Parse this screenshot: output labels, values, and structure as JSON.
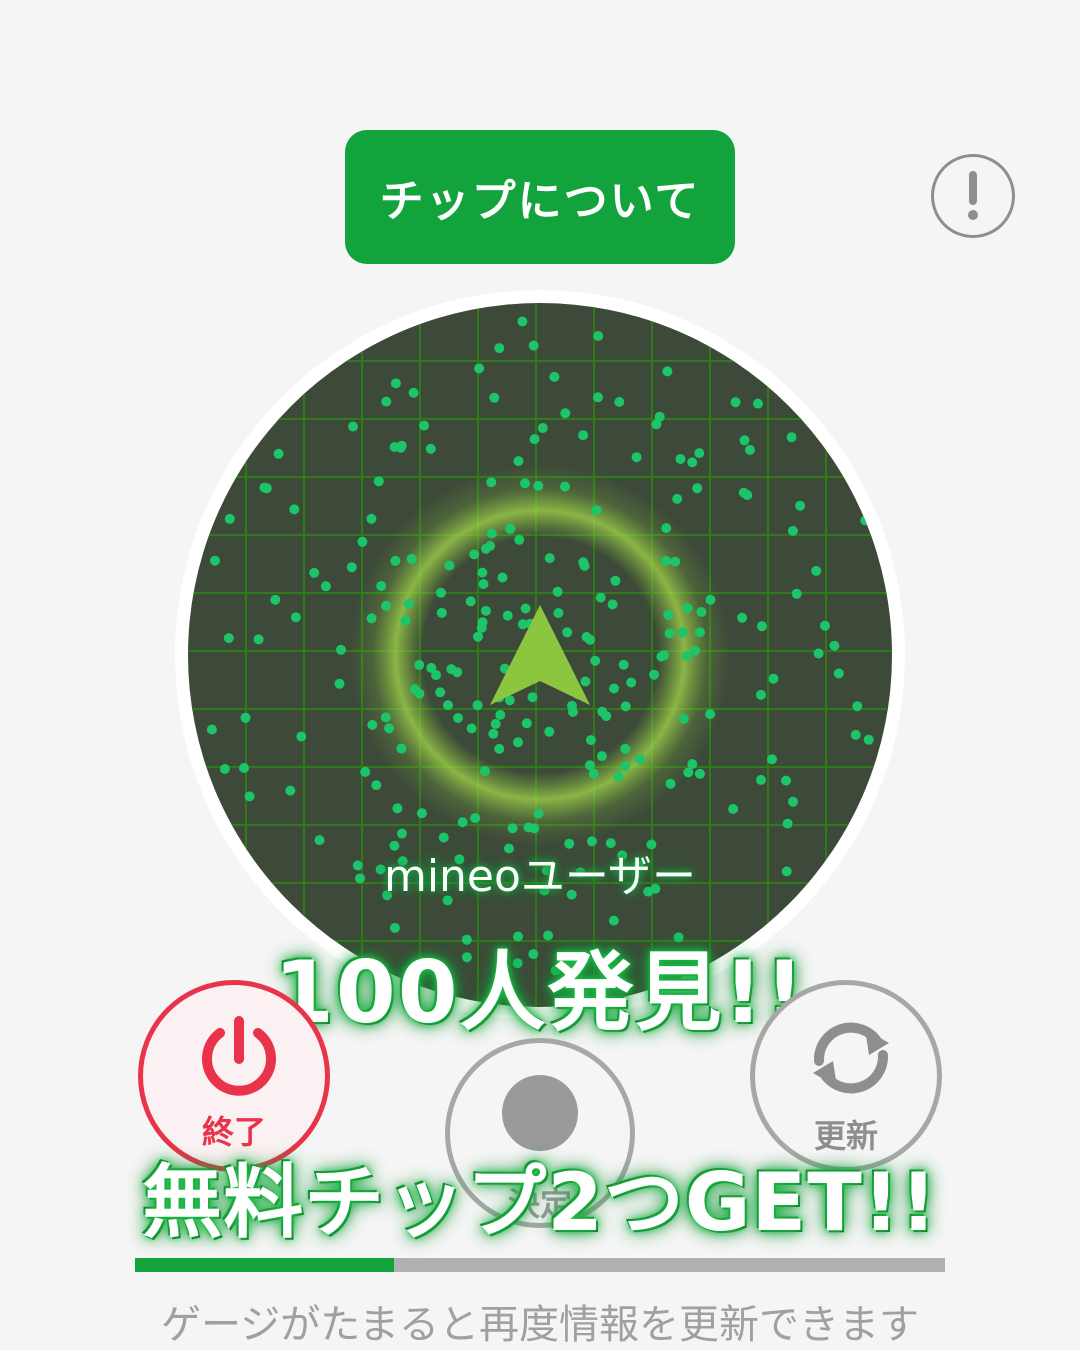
{
  "header": {
    "chip_button_label": "チップについて"
  },
  "info_icon": "exclamation-icon",
  "radar": {
    "background_color": "#3d4a39",
    "grid_color": "#2f7a1a",
    "dot_color": "#1cc46a",
    "arrow_color": "#8cc63f"
  },
  "overlay": {
    "user_label": "mineoユーザー",
    "found_label": "100人発見!!",
    "promo_label": "無料チップ2つGET!!"
  },
  "controls": {
    "end_label": "終了",
    "decide_label": "決定",
    "refresh_label": "更新"
  },
  "gauge": {
    "progress": 0.32
  },
  "hint_text": "ゲージがたまると再度情報を更新できます"
}
